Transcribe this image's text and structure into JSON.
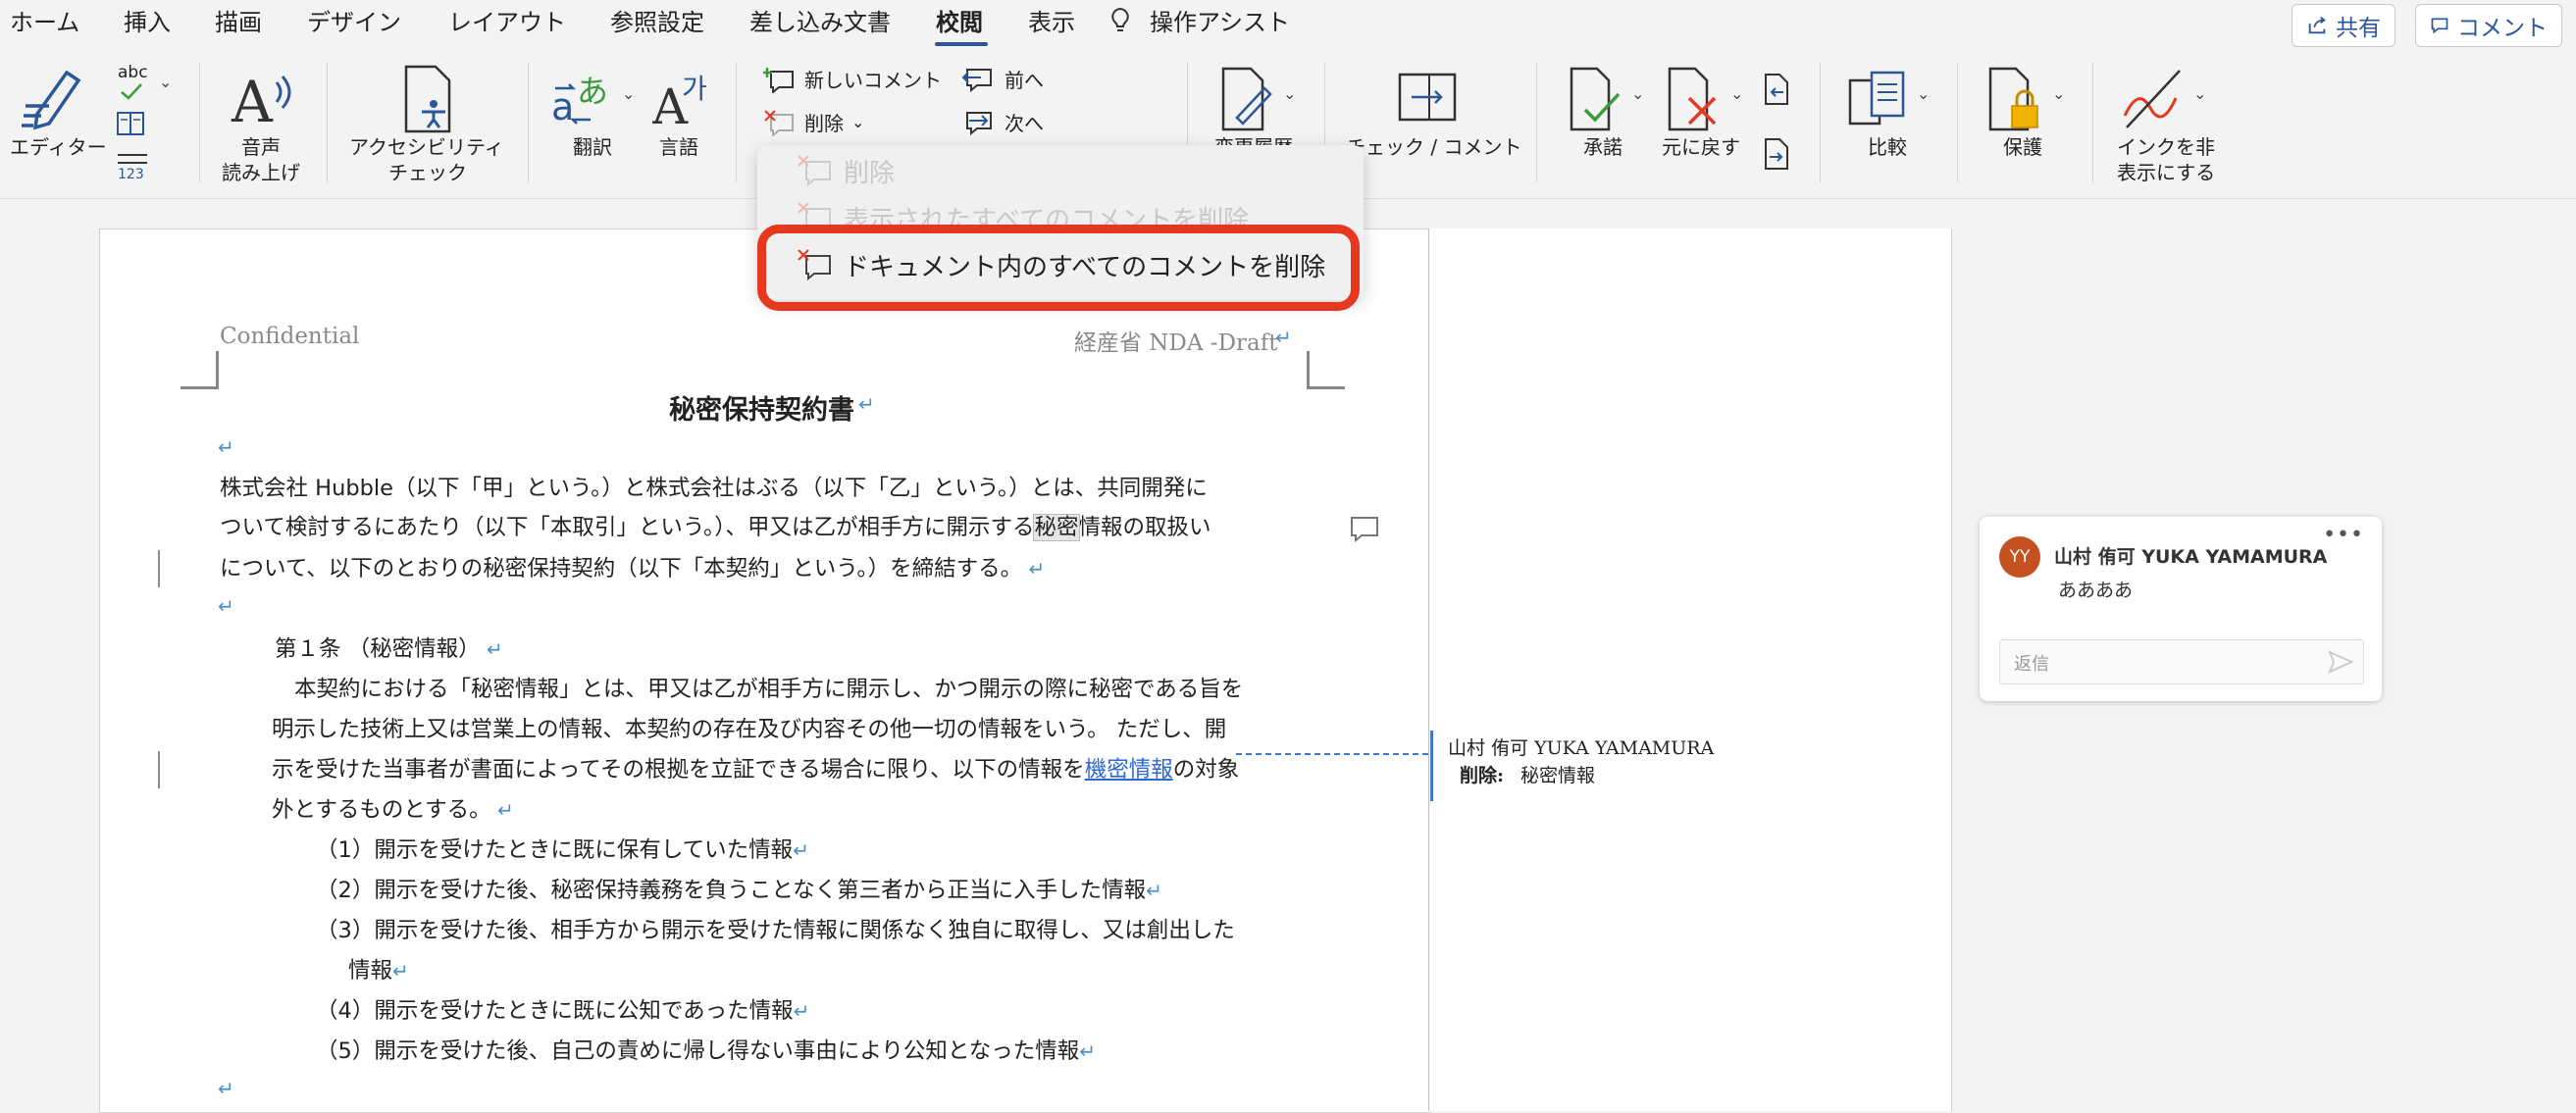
{
  "tabs": [
    "ホーム",
    "挿入",
    "描画",
    "デザイン",
    "レイアウト",
    "参照設定",
    "差し込み文書",
    "校閲",
    "表示",
    "操作アシスト"
  ],
  "top_buttons": {
    "share": "共有",
    "comment": "コメント"
  },
  "ribbon": {
    "editor": "エディター",
    "speech_line1": "音声",
    "speech_line2": "読み上げ",
    "access_line1": "アクセシビリティ",
    "access_line2": "チェック",
    "translate": "翻訳",
    "language": "言語",
    "new_comment": "新しいコメント",
    "delete": "削除",
    "prev": "前へ",
    "next": "次へ",
    "change_history": "変更履歴",
    "check_comment": "チェック / コメント",
    "accept": "承諾",
    "reject": "元に戻す",
    "compare": "比較",
    "protect": "保護",
    "ink_line1": "インクを非",
    "ink_line2": "表示にする",
    "abc": "abc"
  },
  "dropdown": {
    "item1": "削除",
    "item2": "表示されたすべてのコメントを削除",
    "item3": "ドキュメント内のすべてのコメントを削除"
  },
  "document": {
    "header_left": "Confidential",
    "header_right": "経産省 NDA -Draft",
    "title": "秘密保持契約書",
    "p1_l1": "株式会社 Hubble（以下「甲」という。）と株式会社はぶる（以下「乙」という。）とは、共同開発に",
    "p1_l2a": "ついて検討するにあたり（以下「本取引」という。）、甲又は乙が相手方に開示する",
    "p1_l2b": "秘密",
    "p1_l2c": "情報の取扱い",
    "p1_l3": "について、以下のとおりの秘密保持契約（以下「本契約」という。）を締結する。",
    "art1_title": "第１条 （秘密情報）",
    "art1_l1": "本契約における「秘密情報」とは、甲又は乙が相手方に開示し、かつ開示の際に秘密である旨を",
    "art1_l2": "明示した技術上又は営業上の情報、本契約の存在及び内容その他一切の情報をいう。 ただし、開",
    "art1_l3a": "示を受けた当事者が書面によってその根拠を立証できる場合に限り、以下の情報を",
    "art1_l3b": "機密情報",
    "art1_l3c": "の対象",
    "art1_l4": "外とするものとする。",
    "item1": "（1）開示を受けたときに既に保有していた情報",
    "item2": "（2）開示を受けた後、秘密保持義務を負うことなく第三者から正当に入手した情報",
    "item3a": "（3）開示を受けた後、相手方から開示を受けた情報に関係なく独自に取得し、又は創出した",
    "item3b": "情報",
    "item4": "（4）開示を受けたときに既に公知であった情報",
    "item5": "（5）開示を受けた後、自己の責めに帰し得ない事由により公知となった情報"
  },
  "markup_balloon": {
    "author": "山村 侑可 YUKA YAMAMURA",
    "label": "削除:",
    "deleted": "秘密情報"
  },
  "comment": {
    "initials": "YY",
    "author": "山村 侑可 YUKA YAMAMURA",
    "body": "ああああ",
    "reply_placeholder": "返信"
  },
  "colors": {
    "accent": "#2b579a",
    "highlight": "#e6371f",
    "link": "#2a6ad6",
    "avatar": "#c4511f"
  }
}
